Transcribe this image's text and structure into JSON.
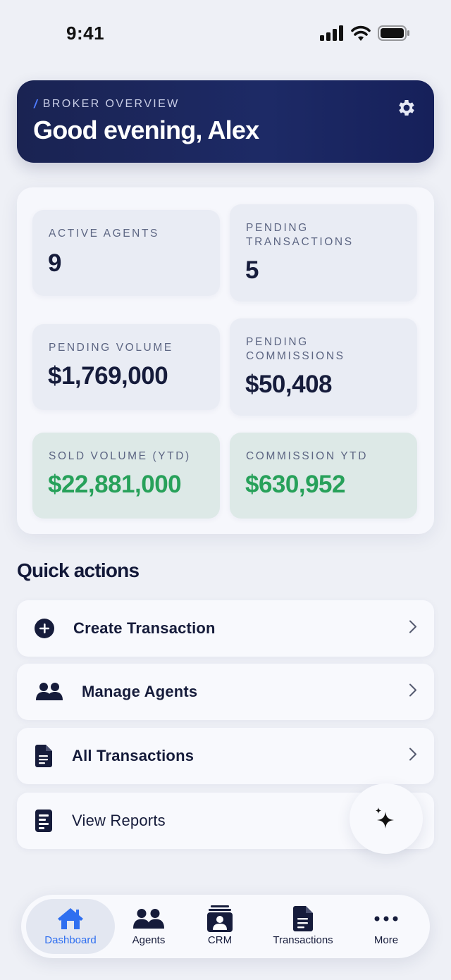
{
  "status": {
    "time": "9:41"
  },
  "header": {
    "kicker": "BROKER OVERVIEW",
    "title": "Good evening, Alex"
  },
  "stats": [
    {
      "label": "ACTIVE AGENTS",
      "value": "9"
    },
    {
      "label": "PENDING TRANSACTIONS",
      "value": "5"
    },
    {
      "label": "PENDING VOLUME",
      "value": "$1,769,000"
    },
    {
      "label": "PENDING COMMISSIONS",
      "value": "$50,408"
    },
    {
      "label": "SOLD VOLUME (YTD)",
      "value": "$22,881,000"
    },
    {
      "label": "COMMISSION YTD",
      "value": "$630,952"
    }
  ],
  "quick_actions": {
    "title": "Quick actions",
    "items": [
      {
        "label": "Create Transaction",
        "icon": "plus-circle-icon"
      },
      {
        "label": "Manage Agents",
        "icon": "people-icon"
      },
      {
        "label": "All Transactions",
        "icon": "document-icon"
      },
      {
        "label": "View Reports",
        "icon": "report-icon"
      }
    ]
  },
  "tabs": [
    {
      "label": "Dashboard",
      "icon": "home-icon",
      "active": true
    },
    {
      "label": "Agents",
      "icon": "people-icon"
    },
    {
      "label": "CRM",
      "icon": "contacts-icon"
    },
    {
      "label": "Transactions",
      "icon": "document-icon"
    },
    {
      "label": "More",
      "icon": "more-icon"
    }
  ],
  "colors": {
    "navy": "#1a2352",
    "accent_blue": "#2f6ff0",
    "positive_green": "#27a15a",
    "green_tile": "#dde9e7"
  }
}
